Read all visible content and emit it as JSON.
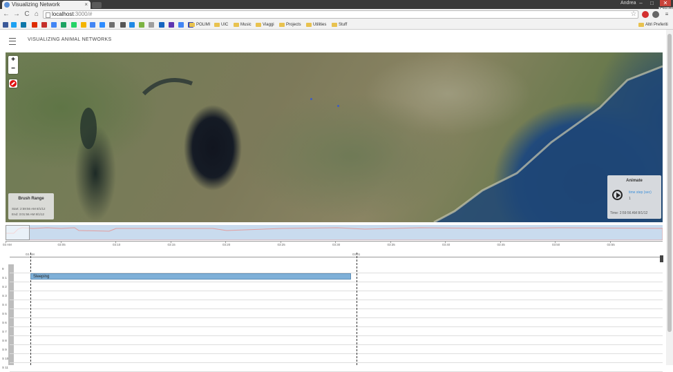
{
  "browser": {
    "tab_title": "Visualizing Network",
    "tab_close": "×",
    "user_name": "Andrea",
    "window_tooltip": "Chiudi",
    "window_controls": {
      "minimize": "–",
      "maximize": "□",
      "close": "✕"
    },
    "nav": {
      "back": "←",
      "forward": "→",
      "reload": "C",
      "home": "⌂"
    },
    "url_host": "localhost",
    "url_rest": ":3000/#",
    "star": "☆",
    "bookmarks": [
      "POLIMI",
      "UIC",
      "Music",
      "Viaggi",
      "Projects",
      "Utilities",
      "Stuff"
    ],
    "other_bookmarks": "Altri Preferiti",
    "bookmark_icon_colors": [
      "#3b5998",
      "#1da1f2",
      "#0e76a8",
      "#dd2c00",
      "#c4302b",
      "#4285f4",
      "#1ea362",
      "#25d366",
      "#f4b400",
      "#4285f4",
      "#2d8cff",
      "#6e6e6e",
      "#555555",
      "#1e88e5",
      "#7cb342",
      "#9e9e9e",
      "#1565c0",
      "#5e35b1",
      "#4285f4",
      "#3949ab",
      "#607d8b",
      "#1976d2"
    ]
  },
  "app": {
    "title": "VISUALIZING ANIMAL NETWORKS"
  },
  "map": {
    "zoom_in": "+",
    "zoom_out": "−"
  },
  "brush_panel": {
    "title": "Brush Range",
    "start": "Start: 2:59:56 AM 8/1/12",
    "end": "End:   3:01:56 AM 8/1/12"
  },
  "animate_panel": {
    "title": "Animate",
    "timestep_label": "time step (sec)",
    "timestep_value": "1",
    "time": "Time: 2:59:56 AM 8/1/12"
  },
  "overview_timeline": {
    "ticks": [
      "03 AM",
      "03:05",
      "03:10",
      "03:15",
      "03:20",
      "03:25",
      "03:30",
      "03:35",
      "03:40",
      "03:45",
      "03:50",
      "03:55"
    ]
  },
  "detail_timeline": {
    "ticks": [
      "03 AM",
      "03:01"
    ],
    "rows": [
      "9",
      "S 1",
      "S 2",
      "S 3",
      "S 4",
      "S 5",
      "S 6",
      "S 7",
      "S 8",
      "S 9",
      "S 10",
      "S 11"
    ],
    "event_label": "Sleeping"
  }
}
